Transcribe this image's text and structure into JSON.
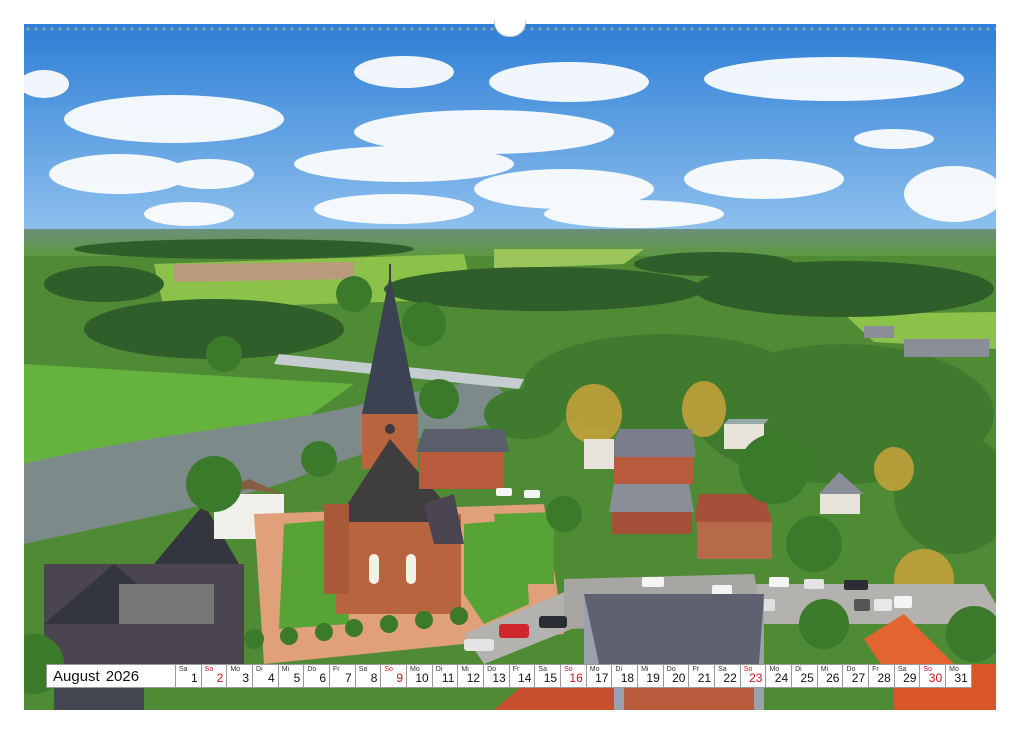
{
  "calendar": {
    "month": "August",
    "year": "2026",
    "days": [
      {
        "wd": "Sa",
        "n": "1",
        "red": false
      },
      {
        "wd": "So",
        "n": "2",
        "red": true
      },
      {
        "wd": "Mo",
        "n": "3",
        "red": false
      },
      {
        "wd": "Di",
        "n": "4",
        "red": false
      },
      {
        "wd": "Mi",
        "n": "5",
        "red": false
      },
      {
        "wd": "Do",
        "n": "6",
        "red": false
      },
      {
        "wd": "Fr",
        "n": "7",
        "red": false
      },
      {
        "wd": "Sa",
        "n": "8",
        "red": false
      },
      {
        "wd": "So",
        "n": "9",
        "red": true
      },
      {
        "wd": "Mo",
        "n": "10",
        "red": false
      },
      {
        "wd": "Di",
        "n": "11",
        "red": false
      },
      {
        "wd": "Mi",
        "n": "12",
        "red": false
      },
      {
        "wd": "Do",
        "n": "13",
        "red": false
      },
      {
        "wd": "Fr",
        "n": "14",
        "red": false
      },
      {
        "wd": "Sa",
        "n": "15",
        "red": false
      },
      {
        "wd": "So",
        "n": "16",
        "red": true
      },
      {
        "wd": "Mo",
        "n": "17",
        "red": false
      },
      {
        "wd": "Di",
        "n": "18",
        "red": false
      },
      {
        "wd": "Mi",
        "n": "19",
        "red": false
      },
      {
        "wd": "Do",
        "n": "20",
        "red": false
      },
      {
        "wd": "Fr",
        "n": "21",
        "red": false
      },
      {
        "wd": "Sa",
        "n": "22",
        "red": false
      },
      {
        "wd": "So",
        "n": "23",
        "red": true
      },
      {
        "wd": "Mo",
        "n": "24",
        "red": false
      },
      {
        "wd": "Di",
        "n": "25",
        "red": false
      },
      {
        "wd": "Mi",
        "n": "26",
        "red": false
      },
      {
        "wd": "Do",
        "n": "27",
        "red": false
      },
      {
        "wd": "Fr",
        "n": "28",
        "red": false
      },
      {
        "wd": "Sa",
        "n": "29",
        "red": false
      },
      {
        "wd": "So",
        "n": "30",
        "red": true
      },
      {
        "wd": "Mo",
        "n": "31",
        "red": false
      }
    ]
  },
  "colors": {
    "sunday_red": "#d0141c",
    "sky": "#4a8fdc",
    "grass": "#5aa23a",
    "roof": "#3b3f4a",
    "brick": "#b85a3c"
  }
}
